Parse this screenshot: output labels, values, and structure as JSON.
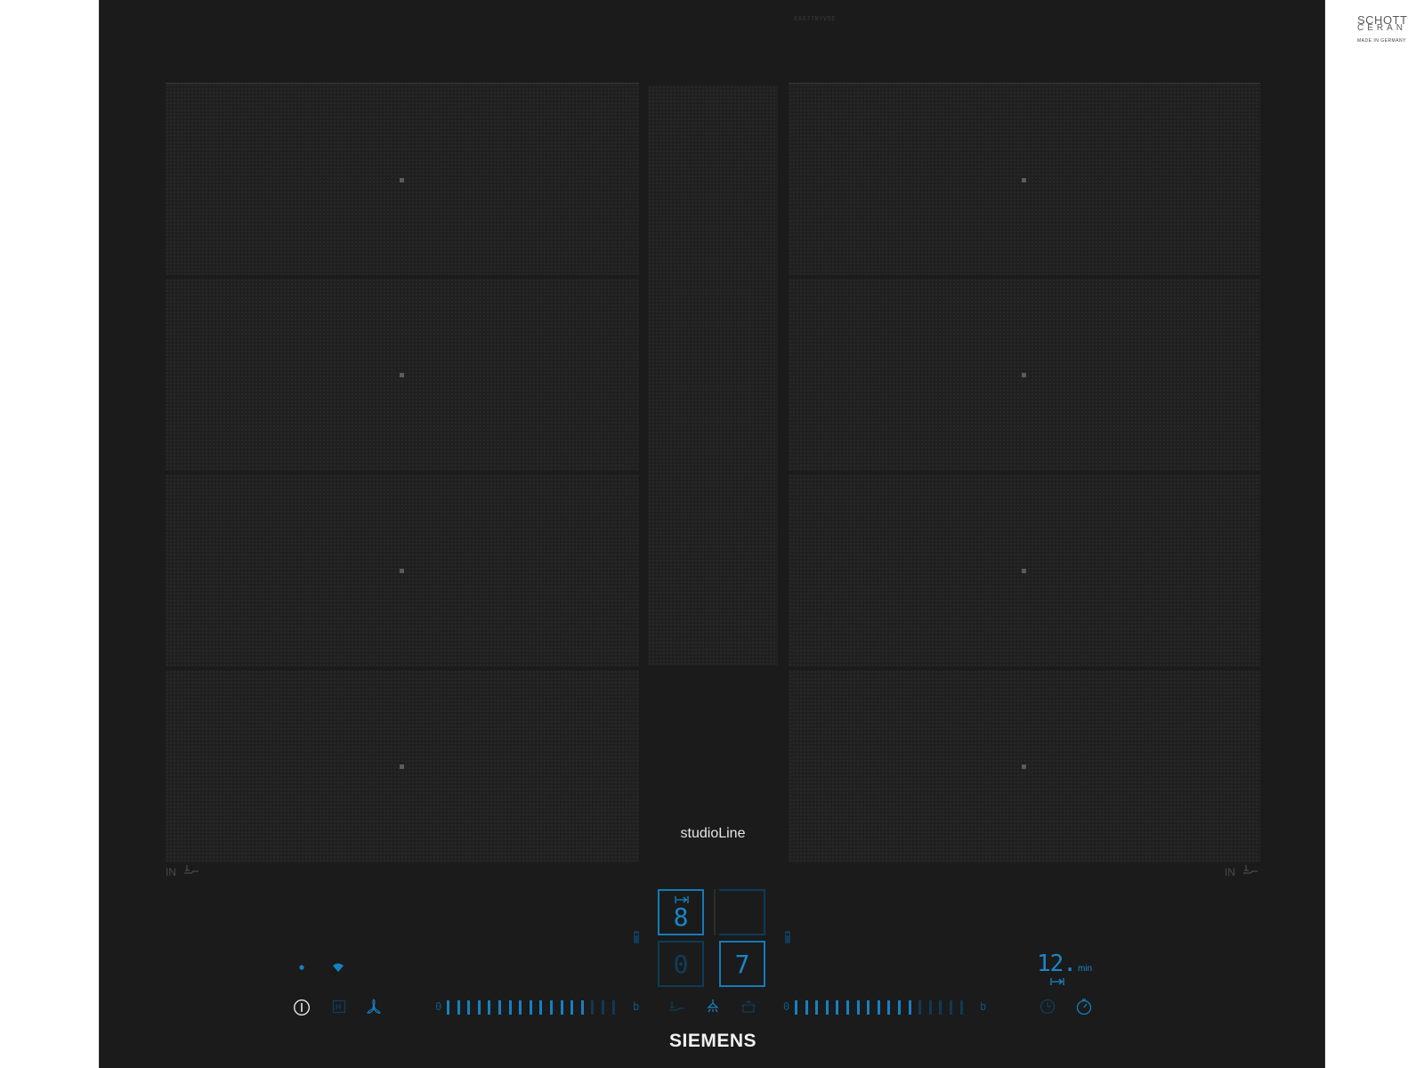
{
  "model_number": "EX677NYV5E",
  "glass_brand": {
    "line1": "SCHOTT",
    "line2": "CERAN",
    "line3": "MADE IN GERMANY"
  },
  "studio_label": "studioLine",
  "brand": "SIEMENS",
  "zone_labels": {
    "left": "IN",
    "right": "IN"
  },
  "displays": {
    "top_left": {
      "digit": "8",
      "icon": "timer-arrow-icon",
      "lit": true
    },
    "top_right": {
      "digit": "",
      "lit": false
    },
    "bottom_left": {
      "digit": "0",
      "lit": false
    },
    "bottom_right": {
      "digit": "7",
      "lit": true
    }
  },
  "timer": {
    "value": "12.",
    "unit": "min"
  },
  "sliders": {
    "left": {
      "start": "0",
      "end": "b",
      "levels": 17,
      "active": 14
    },
    "right": {
      "start": "0",
      "end": "b",
      "levels": 17,
      "active": 12
    }
  },
  "colors": {
    "accent": "#1680c3",
    "dim": "#0e3a56",
    "glass": "#1b1b1b",
    "text": "#e6e6e6"
  }
}
